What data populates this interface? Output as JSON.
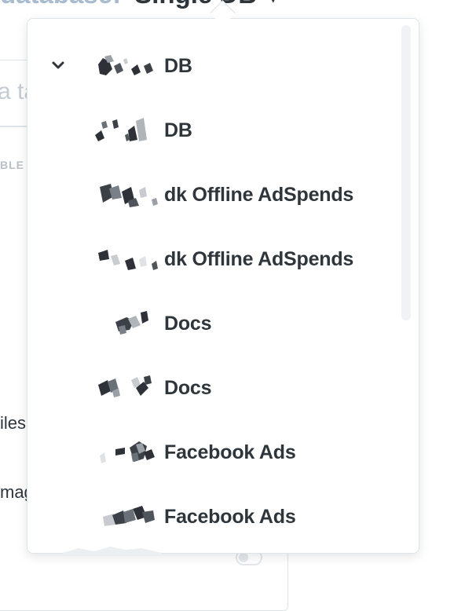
{
  "header": {
    "prefix": "database:",
    "db_name": "Single DB",
    "chevron": "▾"
  },
  "background": {
    "search_placeholder": "a ta",
    "section_label": "BLE",
    "items": [
      "iles",
      "mag"
    ]
  },
  "dropdown": {
    "items": [
      {
        "label": "DB",
        "selected": true
      },
      {
        "label": "DB",
        "selected": false
      },
      {
        "label": "dk Offline AdSpends",
        "selected": false
      },
      {
        "label": "dk Offline AdSpends",
        "selected": false
      },
      {
        "label": "Docs",
        "selected": false
      },
      {
        "label": "Docs",
        "selected": false
      },
      {
        "label": "Facebook Ads",
        "selected": false
      },
      {
        "label": "Facebook Ads",
        "selected": false
      }
    ]
  },
  "icons": {
    "selected_indicator": "chevron-down-icon"
  },
  "colors": {
    "text_dark": "#2e353b",
    "border": "#dfe4e8",
    "muted": "#a8bcd0"
  }
}
